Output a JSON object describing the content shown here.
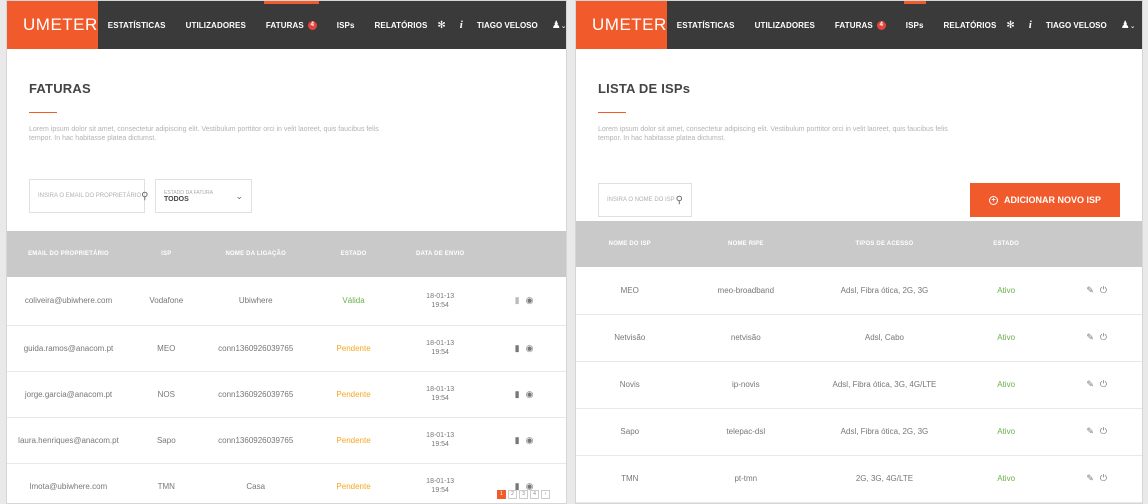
{
  "brand": "UMETER",
  "nav": {
    "estatisticas": "ESTATÍSTICAS",
    "utilizadores": "UTILIZADORES",
    "faturas": "FATURAS",
    "faturas_badge": "4",
    "isps": "ISPs",
    "relatorios": "RELATÓRIOS"
  },
  "user": {
    "name": "TIAGO VELOSO"
  },
  "icons": {
    "settings": "gear-icon",
    "info": "info-icon",
    "user": "user-icon",
    "search": "search-icon",
    "view": "eye-icon",
    "file": "file-icon",
    "edit": "edit-icon",
    "power": "power-icon"
  },
  "colors": {
    "accent": "#f15a2b",
    "valid": "#6ab04c",
    "pending": "#f5a623",
    "nav_bg": "#3a3a3a"
  },
  "faturas": {
    "title": "FATURAS",
    "description": "Lorem ipsum dolor sit amet, consectetur adipiscing elit. Vestibulum porttitor orci in velit laoreet, quis faucibus felis tempor. In hac habitasse platea dictumst.",
    "search_placeholder": "INSIRA O EMAIL DO PROPRIETÁRIO",
    "status_filter_label": "ESTADO DA FATURA",
    "status_filter_value": "TODOS",
    "columns": [
      "EMAIL DO PROPRIETÁRIO",
      "ISP",
      "NOME DA LIGAÇÃO",
      "ESTADO",
      "DATA DE ENVIO"
    ],
    "rows": [
      {
        "email": "coliveira@ubiwhere.com",
        "isp": "Vodafone",
        "ligacao": "Ubiwhere",
        "estado": "Válida",
        "data": "18-01-13",
        "hora": "19:54",
        "state": "ok"
      },
      {
        "email": "guida.ramos@anacom.pt",
        "isp": "MEO",
        "ligacao": "conn1360926039765",
        "estado": "Pendente",
        "data": "18-01-13",
        "hora": "19:54",
        "state": "pend"
      },
      {
        "email": "jorge.garcia@anacom.pt",
        "isp": "NOS",
        "ligacao": "conn1360926039765",
        "estado": "Pendente",
        "data": "18-01-13",
        "hora": "19:54",
        "state": "pend"
      },
      {
        "email": "laura.henriques@anacom.pt",
        "isp": "Sapo",
        "ligacao": "conn1360926039765",
        "estado": "Pendente",
        "data": "18-01-13",
        "hora": "19:54",
        "state": "pend"
      },
      {
        "email": "lmota@ubiwhere.com",
        "isp": "TMN",
        "ligacao": "Casa",
        "estado": "Pendente",
        "data": "18-01-13",
        "hora": "19:54",
        "state": "pend"
      }
    ],
    "pagination": [
      "1",
      "2",
      "3",
      "4",
      "›"
    ]
  },
  "isps": {
    "title": "LISTA DE ISPs",
    "description": "Lorem ipsum dolor sit amet, consectetur adipiscing elit. Vestibulum porttitor orci in velit laoreet, quis faucibus felis tempor. In hac habitasse platea dictumst.",
    "search_placeholder": "INSIRA O NOME DO ISP",
    "add_button": "ADICIONAR NOVO ISP",
    "columns": [
      "NOME DO ISP",
      "NOME RIPE",
      "TIPOS DE ACESSO",
      "ESTADO",
      ""
    ],
    "rows": [
      {
        "nome": "MEO",
        "ripe": "meo-broadband",
        "acesso": "Adsl, Fibra ótica, 2G, 3G",
        "estado": "Ativo"
      },
      {
        "nome": "Netvisão",
        "ripe": "netvisão",
        "acesso": "Adsl, Cabo",
        "estado": "Ativo"
      },
      {
        "nome": "Novis",
        "ripe": "ip-novis",
        "acesso": "Adsl, Fibra ótica, 3G, 4G/LTE",
        "estado": "Ativo"
      },
      {
        "nome": "Sapo",
        "ripe": "telepac-dsl",
        "acesso": "Adsl, Fibra ótica, 2G, 3G",
        "estado": "Ativo"
      },
      {
        "nome": "TMN",
        "ripe": "pt-tmn",
        "acesso": "2G, 3G, 4G/LTE",
        "estado": "Ativo"
      }
    ]
  }
}
